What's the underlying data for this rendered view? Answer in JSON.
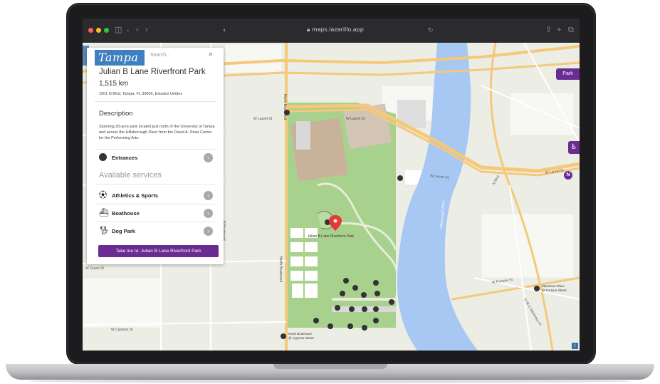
{
  "browser": {
    "url": "maps.lazarillo.app"
  },
  "map_controls": {
    "park_button": "Park",
    "accessibility_icon": "wheelchair-icon",
    "compass_label": "N",
    "info_label": "i"
  },
  "map_labels": {
    "w_laurel_st_1": "W Laurel St",
    "w_laurel_st_2": "W Laurel St",
    "w_laurel_st_3": "W Laurel St",
    "w_laurel_st_4": "W Laurel St",
    "north_boulevard_1": "North Boulevard",
    "north_boulevard_2": "North Boulevard",
    "n_boulevard": "N Boulevard",
    "w_grace_st": "W Grace St",
    "w_cypress_st": "W Cypress St",
    "w_fortune_st": "W Fortune St",
    "n_w_c_macinnes_pl": "N W C Macinnes Pl",
    "macinnes_place": "Macinnes Place",
    "macinnes_place_sub": "@ Fortune Street",
    "north_boulevard_stop": "North Boulevard",
    "north_boulevard_stop_sub": "@ Cypress Street",
    "park_marker": "Julian B Lane Riverfront Park",
    "river": "Hillsborough River",
    "n_blvd_short": "N Blvd"
  },
  "panel": {
    "logo_text": "Tampa",
    "search_placeholder": "Search...",
    "title": "Julian B Lane Riverfront Park",
    "distance": "1,515 km",
    "address": "1001 N Blvd, Tampa, FL 33606, Estados Unidos",
    "description_heading": "Description",
    "description": "Stunning 25-acre park located just north of the University of Tampa and across the Hillsborough River from the David A. Straz Center for the Performing Arts.",
    "entrances_label": "Entrances",
    "available_services": "Available services",
    "services": [
      {
        "label": "Athletics & Sports",
        "icon": "ball-icon"
      },
      {
        "label": "Boathouse",
        "icon": "boat-icon"
      },
      {
        "label": "Dog Park",
        "icon": "dog-icon"
      }
    ],
    "cta": "Take me to: Julian B Lane Riverfront Park"
  },
  "colors": {
    "accent": "#6a2c91",
    "park_green": "#a8d18d",
    "river_blue": "#a7c8f2",
    "road_orange": "#f5c87a",
    "marker_red": "#e53935"
  }
}
